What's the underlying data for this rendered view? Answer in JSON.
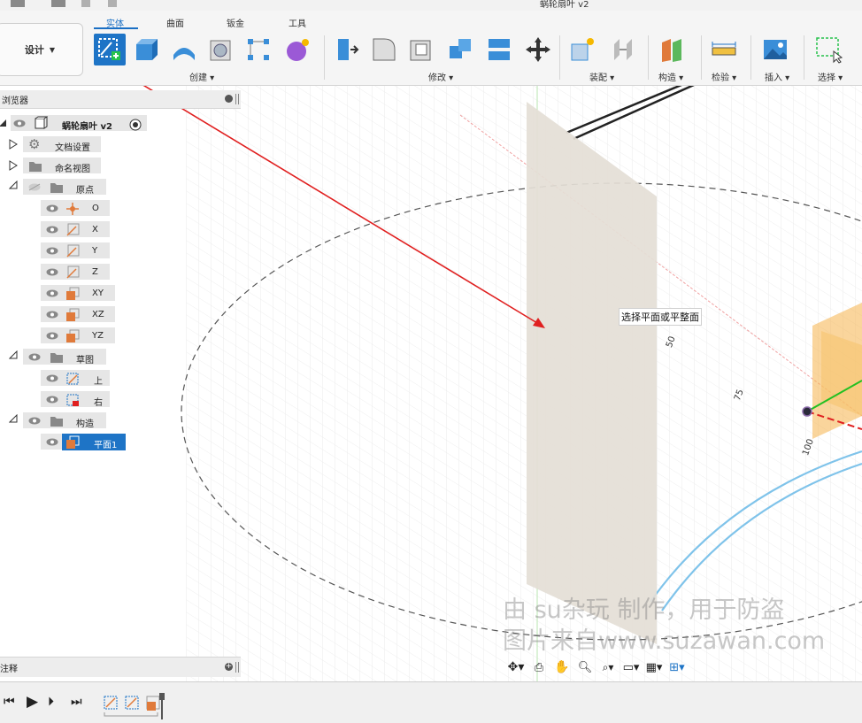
{
  "title": "蜗轮扇叶 v2",
  "workspace": {
    "label": "设计"
  },
  "tabs": [
    {
      "label": "实体",
      "active": true
    },
    {
      "label": "曲面",
      "active": false
    },
    {
      "label": "钣金",
      "active": false
    },
    {
      "label": "工具",
      "active": false
    }
  ],
  "toolbar_groups": {
    "create": "创建",
    "modify": "修改",
    "assemble": "装配",
    "construct": "构造",
    "inspect": "检验",
    "insert": "插入",
    "select": "选择"
  },
  "browser": {
    "title": "浏览器",
    "root": "蜗轮扇叶 v2",
    "items": [
      {
        "label": "文档设置",
        "icon": "gear-icon"
      },
      {
        "label": "命名视图",
        "icon": "folder-icon"
      },
      {
        "label": "原点",
        "icon": "folder-icon"
      },
      {
        "label": "O",
        "icon": "origin-point-icon"
      },
      {
        "label": "X",
        "icon": "axis-icon"
      },
      {
        "label": "Y",
        "icon": "axis-icon"
      },
      {
        "label": "Z",
        "icon": "axis-icon"
      },
      {
        "label": "XY",
        "icon": "plane-icon"
      },
      {
        "label": "XZ",
        "icon": "plane-icon"
      },
      {
        "label": "YZ",
        "icon": "plane-icon"
      },
      {
        "label": "草图",
        "icon": "folder-icon"
      },
      {
        "label": "上",
        "icon": "sketch-icon"
      },
      {
        "label": "右",
        "icon": "sketch-locked-icon"
      },
      {
        "label": "构造",
        "icon": "folder-icon"
      },
      {
        "label": "平面1",
        "icon": "plane-icon"
      }
    ]
  },
  "comments": {
    "title": "注释"
  },
  "canvas": {
    "tooltip": "选择平面或平整面",
    "dimension_labels": [
      "50",
      "75",
      "100"
    ],
    "watermark_line1": "由 su杂玩 制作，用于防盗",
    "watermark_line2": "图片来自www.suzawan.com"
  },
  "colors": {
    "accent": "#1e74c6",
    "plane_fill": "#e4ded6",
    "red_axis": "#e02020",
    "green_axis": "#22c022",
    "orange_plane": "#f5b24a",
    "blue_curve": "#7fc3ea"
  }
}
